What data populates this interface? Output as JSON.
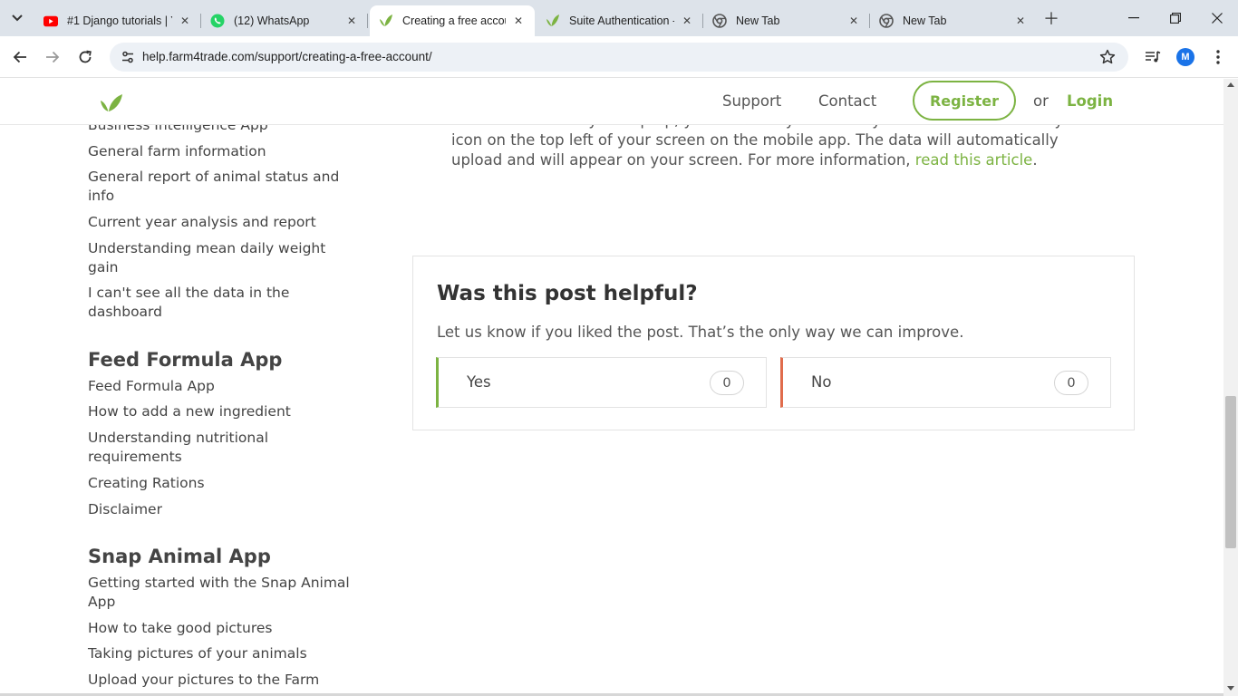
{
  "browser": {
    "tabs": [
      {
        "title": "#1 Django tutorials | Y",
        "icon": "youtube-icon",
        "active": false
      },
      {
        "title": "(12) WhatsApp",
        "icon": "whatsapp-icon",
        "active": false
      },
      {
        "title": "Creating a free accou",
        "icon": "leaf-icon",
        "active": true
      },
      {
        "title": "Suite Authentication -",
        "icon": "leaf-icon",
        "active": false
      },
      {
        "title": "New Tab",
        "icon": "chrome-icon",
        "active": false
      },
      {
        "title": "New Tab",
        "icon": "chrome-icon",
        "active": false
      }
    ],
    "url": "help.farm4trade.com/support/creating-a-free-account/",
    "profile_initial": "M",
    "colors": {
      "tabbar": "#dde3ea",
      "omnibox": "#edf1f6",
      "profile": "#1a73e8"
    }
  },
  "header": {
    "nav": {
      "support": "Support",
      "contact": "Contact"
    },
    "register": "Register",
    "or": "or",
    "login": "Login",
    "brand_color": "#7cb342"
  },
  "sidebar": {
    "bi_links": [
      "Business Intelligence App",
      "General farm information",
      "General report of animal status and info",
      "Current year analysis and report",
      "Understanding mean daily weight gain",
      "I can't see all the data in the dashboard"
    ],
    "feed_heading": "Feed Formula App",
    "feed_links": [
      "Feed Formula App",
      "How to add a new ingredient",
      "Understanding nutritional requirements",
      "Creating Rations",
      "Disclaimer"
    ],
    "snap_heading": "Snap Animal App",
    "snap_links": [
      "Getting started with the Snap Animal App",
      "How to take good pictures",
      "Taking pictures of your animals",
      "Upload your pictures to the Farm"
    ]
  },
  "article": {
    "line_partial": "another device or your laptop, you need to synchronize your data. Click on the sync",
    "line_2": "icon on the top left of your screen on the mobile app. The data will automatically",
    "line_3_start": "upload and will appear on your screen. For more information,",
    "link": "read this article",
    "line_3_end": "."
  },
  "feedback": {
    "title": "Was this post helpful?",
    "subtitle": "Let us know if you liked the post. That’s the only way we can improve.",
    "yes_label": "Yes",
    "yes_count": "0",
    "no_label": "No",
    "no_count": "0",
    "yes_color": "#7cb342",
    "no_color": "#e06c4c"
  }
}
